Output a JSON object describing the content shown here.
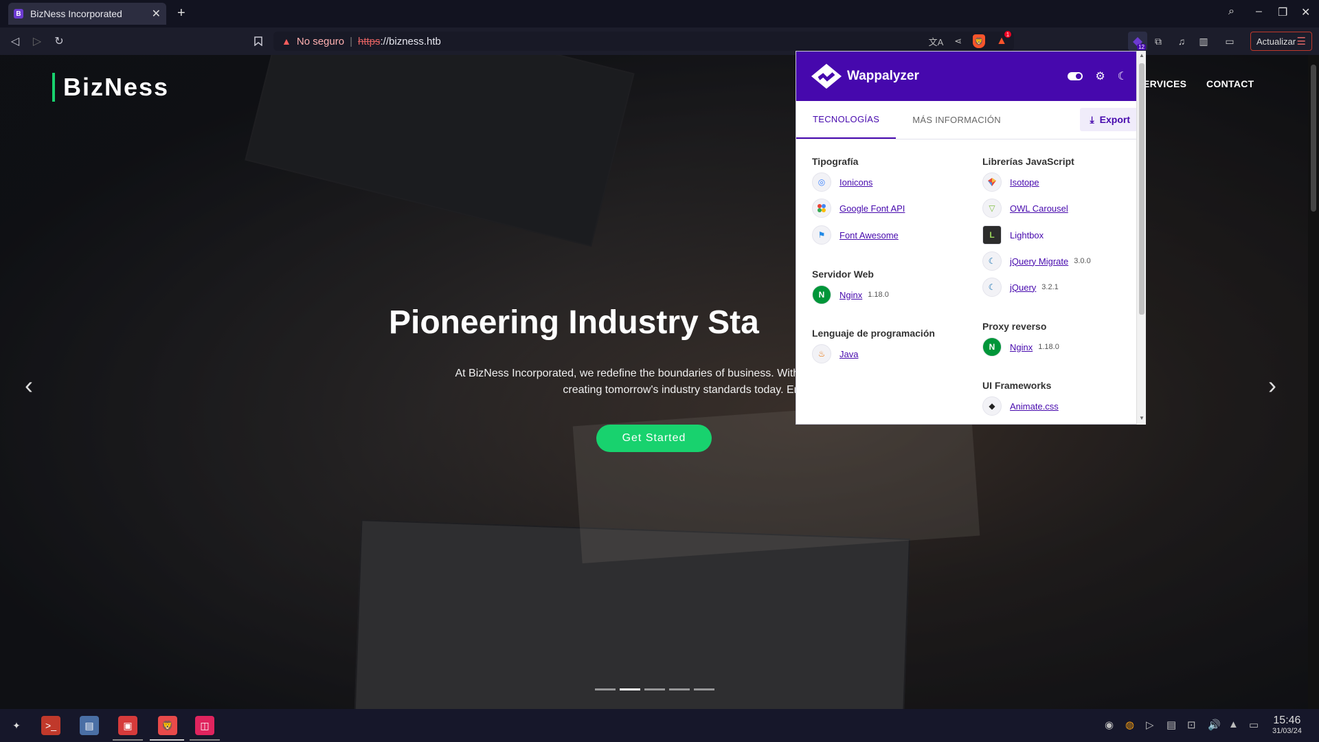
{
  "browser": {
    "tab_title": "BizNess Incorporated",
    "tab_favicon": "B",
    "new_tab_glyph": "+",
    "url_security": "No seguro",
    "url_scheme": "https",
    "url_rest": "://bizness.htb",
    "update_label": "Actualizar",
    "extension_badge": "12"
  },
  "site": {
    "brand": "BizNess",
    "nav": {
      "services": "ERVICES",
      "contact": "CONTACT"
    },
    "hero_title": "Pioneering Industry Sta",
    "hero_line1": "At BizNess Incorporated, we redefine the boundaries of business. With cutting-edge strategies and a",
    "hero_line2": "creating tomorrow's industry standards today. Embark on a path of transforma",
    "cta": "Get Started",
    "carousel_slides": 5,
    "carousel_active": 2
  },
  "wappalyzer": {
    "title": "Wappalyzer",
    "tabs": {
      "technologies": "TECNOLOGÍAS",
      "more_info": "MÁS INFORMACIÓN"
    },
    "export_label": "Export",
    "left": {
      "typography": {
        "title": "Tipografía",
        "items": [
          {
            "name": "Ionicons",
            "icon": "ionicons-icon"
          },
          {
            "name": "Google Font API",
            "icon": "google-fonts-icon"
          },
          {
            "name": "Font Awesome",
            "icon": "font-awesome-icon"
          }
        ]
      },
      "web_server": {
        "title": "Servidor Web",
        "items": [
          {
            "name": "Nginx",
            "version": "1.18.0",
            "icon": "nginx-icon"
          }
        ]
      },
      "language": {
        "title": "Lenguaje de programación",
        "items": [
          {
            "name": "Java",
            "icon": "java-icon"
          }
        ]
      }
    },
    "right": {
      "js_libraries": {
        "title": "Librerías JavaScript",
        "items": [
          {
            "name": "Isotope",
            "icon": "isotope-icon"
          },
          {
            "name": "OWL Carousel",
            "icon": "owl-carousel-icon"
          },
          {
            "name": "Lightbox",
            "icon": "lightbox-icon"
          },
          {
            "name": "jQuery Migrate",
            "version": "3.0.0",
            "icon": "jquery-icon"
          },
          {
            "name": "jQuery",
            "version": "3.2.1",
            "icon": "jquery-icon"
          }
        ]
      },
      "reverse_proxy": {
        "title": "Proxy reverso",
        "items": [
          {
            "name": "Nginx",
            "version": "1.18.0",
            "icon": "nginx-icon"
          }
        ]
      },
      "ui_frameworks": {
        "title": "UI Frameworks",
        "items": [
          {
            "name": "Animate.css",
            "icon": "animate-css-icon"
          }
        ]
      }
    }
  },
  "taskbar": {
    "time": "15:46",
    "date": "31/03/24"
  },
  "colors": {
    "brand_green": "#18d26e",
    "wappalyzer_purple": "#4608ad",
    "insecure_red": "#e46262"
  }
}
